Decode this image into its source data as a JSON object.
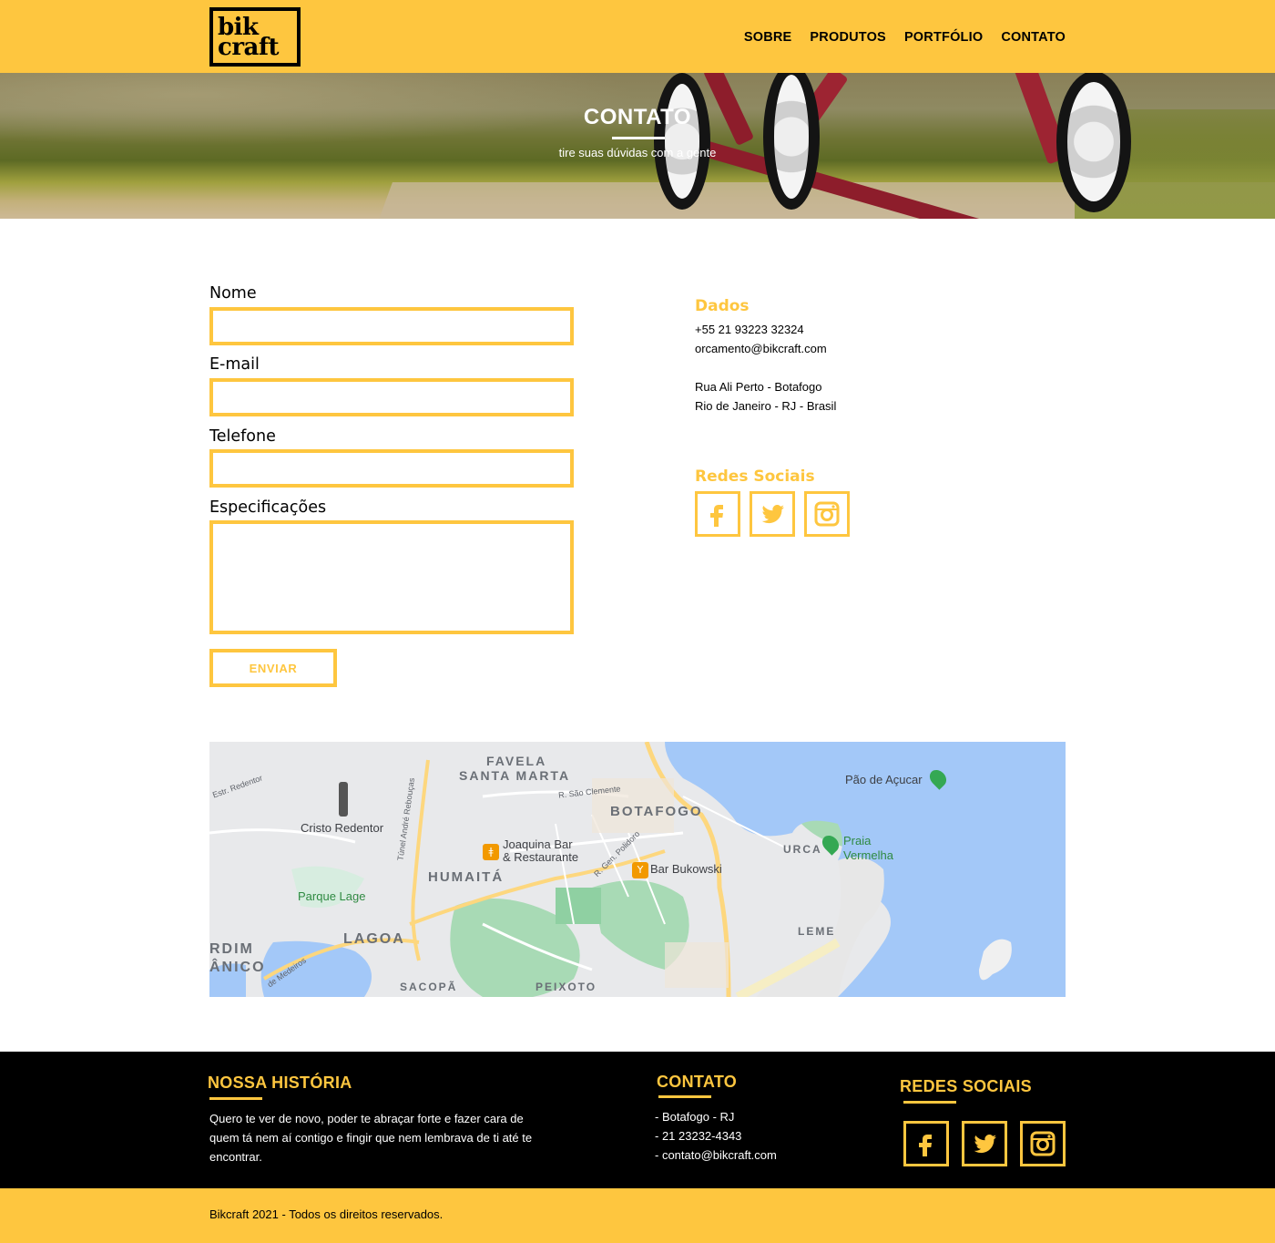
{
  "header": {
    "logo_line1": "bik",
    "logo_line2": "craft",
    "nav": [
      "SOBRE",
      "PRODUTOS",
      "PORTFÓLIO",
      "CONTATO"
    ]
  },
  "hero": {
    "title": "CONTATO",
    "subtitle": "tire suas dúvidas com a gente"
  },
  "form": {
    "fields": [
      {
        "label": "Nome",
        "value": ""
      },
      {
        "label": "E-mail",
        "value": ""
      },
      {
        "label": "Telefone",
        "value": ""
      },
      {
        "label": "Especificações",
        "value": ""
      }
    ],
    "submit_label": "ENVIAR"
  },
  "info": {
    "dados_title": "Dados",
    "phone": "+55 21 93223 32324",
    "email": "orcamento@bikcraft.com",
    "address1": "Rua Ali Perto - Botafogo",
    "address2": "Rio de Janeiro - RJ - Brasil",
    "social_title": "Redes Sociais",
    "social_icons": [
      "facebook-icon",
      "twitter-icon",
      "instagram-icon"
    ]
  },
  "map": {
    "labels": {
      "favela": "FAVELA",
      "santa_marta": "SANTA MARTA",
      "botafogo": "BOTAFOGO",
      "pao": "Pão de Açucar",
      "cristo": "Cristo Redentor",
      "joaquina1": "Joaquina Bar",
      "joaquina2": "& Restaurante",
      "humaita": "HUMAITÁ",
      "bukowski": "Bar Bukowski",
      "urca": "URCA",
      "praia1": "Praia",
      "praia2": "Vermelha",
      "parque": "Parque Lage",
      "lagoa": "LAGOA",
      "leme": "LEME",
      "rdim": "RDIM",
      "anico": "ÂNICO",
      "sacopa": "SACOPÃ",
      "peixoto": "PEIXOTO",
      "sao_clemente": "R. São Clemente",
      "tunel": "Túnel André Rebouças",
      "estr": "Estr. Redentor",
      "gen": "R. Gen. Polidoro",
      "medeiros": "de Medeiros"
    }
  },
  "footer": {
    "history_title": "NOSSA HISTÓRIA",
    "history_text": "Quero te ver de novo, poder te abraçar forte e fazer cara de quem tá nem aí contigo e fingir que nem lembrava de ti até te encontrar.",
    "contact_title": "CONTATO",
    "contact_items": [
      "-  Botafogo - RJ",
      "-  21 23232-4343",
      "-  contato@bikcraft.com"
    ],
    "social_title": "REDES SOCIAIS",
    "copyright": "Bikcraft 2021 - Todos os direitos reservados."
  },
  "colors": {
    "accent": "#FEC63F",
    "footer_bg": "#000000",
    "map_water": "#A3C8F8",
    "map_park": "#A8DAB5"
  }
}
